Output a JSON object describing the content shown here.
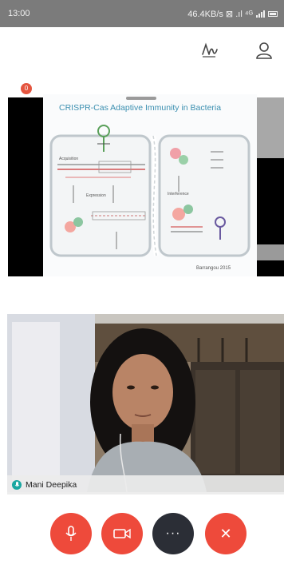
{
  "status_bar": {
    "time": "13:00",
    "network_info": "46.4KB/s ⊠ .ıl ⁴ᴳ",
    "battery_icon": "battery-icon"
  },
  "toolbar": {
    "whiteboard_icon": "whiteboard-signature-icon",
    "participants_icon": "person-icon"
  },
  "shared_screen": {
    "badge_count": "0",
    "slide_title": "CRISPR-Cas Adaptive Immunity in Bacteria",
    "slide_labels": {
      "left_phase_top": "Acquisition",
      "left_phase_mid": "Expression",
      "right_phase": "Interference",
      "cite": "Barrangou 2015"
    }
  },
  "video": {
    "participant_name": "Mani Deepika"
  },
  "controls": {
    "mute_icon": "microphone-icon",
    "video_icon": "video-camera-icon",
    "more_icon": "more-dots-icon",
    "end_icon": "close-icon",
    "more_glyph": "···",
    "end_glyph": "✕"
  },
  "colors": {
    "accent_red": "#ee4a3b",
    "dark_button": "#2b2e36",
    "status_bar": "#7b7b7b",
    "slide_title": "#3b8fb0",
    "mic_indicator": "#1aa7a1"
  }
}
